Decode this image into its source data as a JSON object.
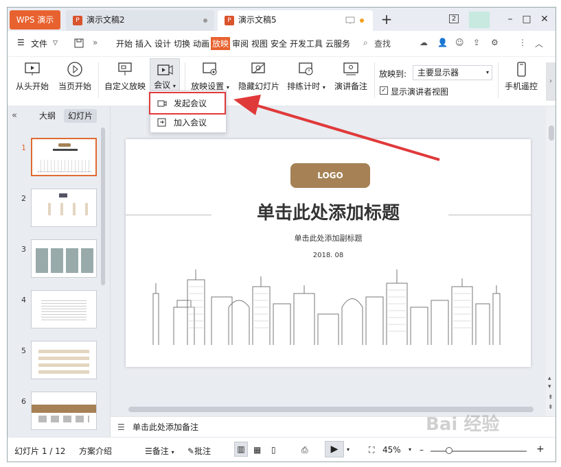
{
  "titlebar": {
    "app_label": "WPS 演示",
    "tabs": [
      {
        "label": "演示文稿2"
      },
      {
        "label": "演示文稿5"
      }
    ],
    "new_tab": "+",
    "badge": "2"
  },
  "menu": {
    "file": "文件",
    "items": [
      "开始",
      "插入",
      "设计",
      "切换",
      "动画",
      "放映",
      "审阅",
      "视图",
      "安全",
      "开发工具",
      "云服务"
    ],
    "active": "放映",
    "search": "查找"
  },
  "ribbon": {
    "from_start": "从头开始",
    "from_current": "当页开始",
    "custom": "自定义放映",
    "meeting": "会议",
    "settings": "放映设置",
    "hide": "隐藏幻灯片",
    "rehearse": "排练计时",
    "notes": "演讲备注",
    "show_to_label": "放映到:",
    "show_to_value": "主要显示器",
    "presenter_view": "显示演讲者视图",
    "remote": "手机遥控"
  },
  "dropdown": {
    "start": "发起会议",
    "join": "加入会议"
  },
  "leftpane": {
    "outline_tab": "大纲",
    "slides_tab": "幻灯片",
    "thumbnails": [
      "1",
      "2",
      "3",
      "4",
      "5",
      "6"
    ]
  },
  "slide": {
    "logo": "LOGO",
    "title": "单击此处添加标题",
    "subtitle": "单击此处添加副标题",
    "date": "2018. 08"
  },
  "notes_placeholder": "单击此处添加备注",
  "status": {
    "slide_info": "幻灯片 1 / 12",
    "theme": "方案介绍",
    "notes": "备注",
    "comments": "批注",
    "zoom": "45%"
  },
  "watermark": "Bai 经验",
  "colors": {
    "accent": "#e8622f",
    "logo_brown": "#a58155",
    "highlight_red": "#e0393a"
  }
}
